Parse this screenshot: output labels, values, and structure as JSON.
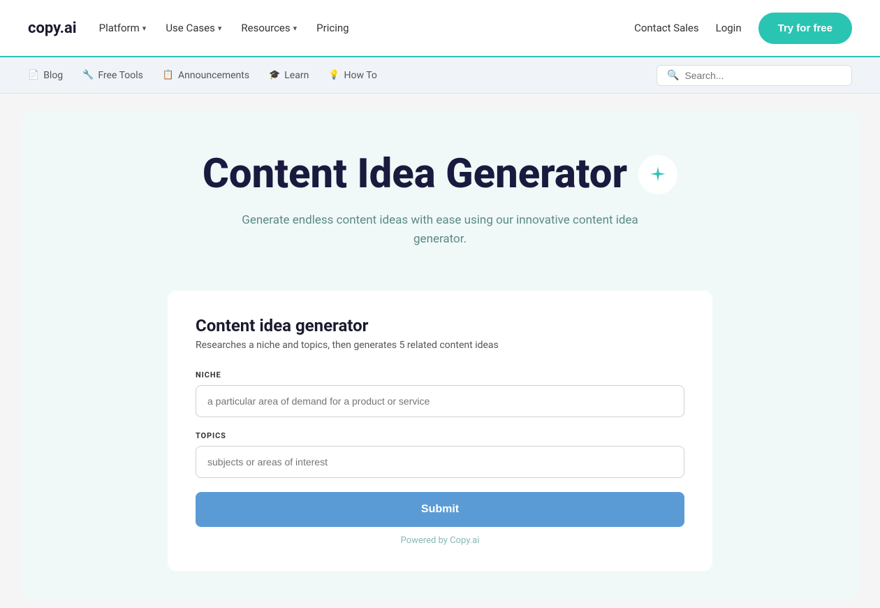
{
  "logo": {
    "text": "copy.ai"
  },
  "nav": {
    "links": [
      {
        "label": "Platform",
        "has_dropdown": true
      },
      {
        "label": "Use Cases",
        "has_dropdown": true
      },
      {
        "label": "Resources",
        "has_dropdown": true
      },
      {
        "label": "Pricing",
        "has_dropdown": false
      }
    ],
    "right": {
      "contact": "Contact Sales",
      "login": "Login",
      "try_btn": "Try for free"
    }
  },
  "sub_nav": {
    "links": [
      {
        "label": "Blog",
        "icon": "📄"
      },
      {
        "label": "Free Tools",
        "icon": "🔧"
      },
      {
        "label": "Announcements",
        "icon": "📋"
      },
      {
        "label": "Learn",
        "icon": "🎓"
      },
      {
        "label": "How To",
        "icon": "💡"
      }
    ],
    "search": {
      "placeholder": "Search..."
    }
  },
  "hero": {
    "title": "Content Idea Generator",
    "subtitle": "Generate endless content ideas with ease using our innovative content idea generator."
  },
  "tool": {
    "title": "Content idea generator",
    "description": "Researches a niche and topics, then generates 5 related content ideas",
    "fields": [
      {
        "id": "niche",
        "label": "NICHE",
        "placeholder": "a particular area of demand for a product or service"
      },
      {
        "id": "topics",
        "label": "TOPICS",
        "placeholder": "subjects or areas of interest"
      }
    ],
    "submit_label": "Submit",
    "powered_by": "Powered by Copy.ai"
  }
}
